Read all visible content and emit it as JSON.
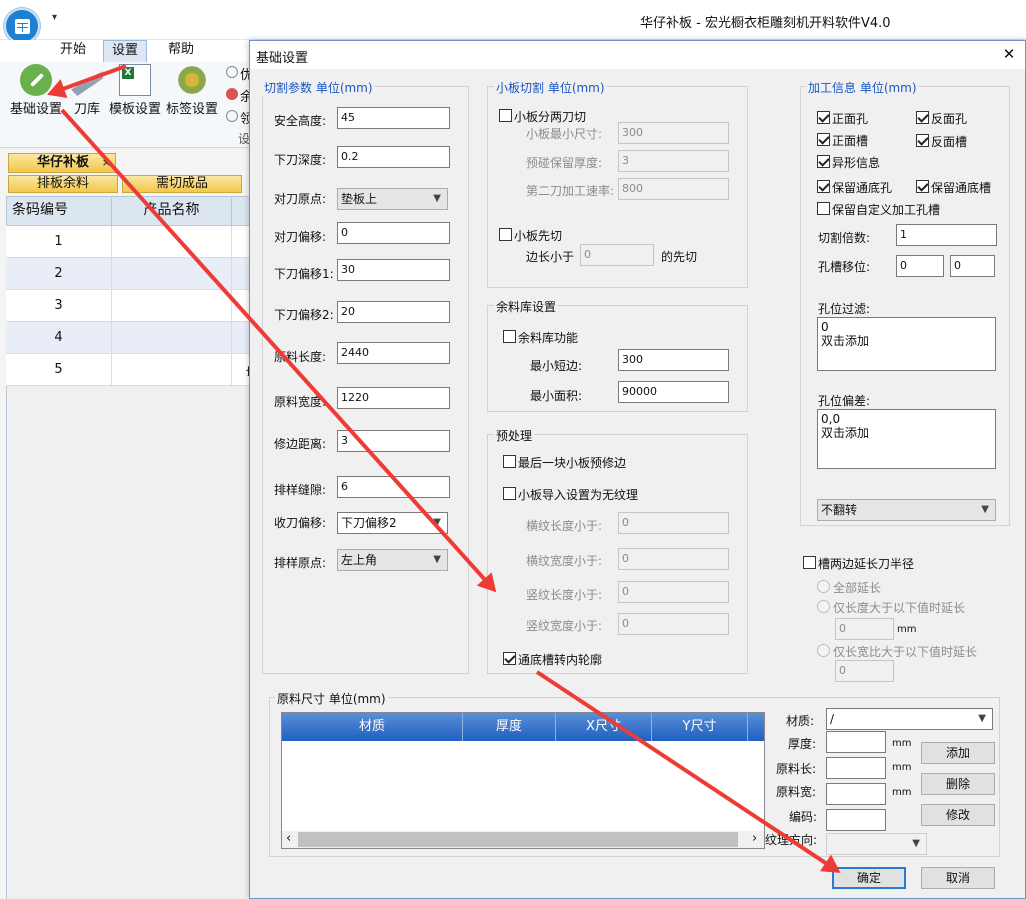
{
  "window": {
    "title": "华仔补板 - 宏光橱衣柜雕刻机开料软件V4.0",
    "qa_glyph": "▾"
  },
  "menu": {
    "items": [
      "开始",
      "设置",
      "帮助"
    ]
  },
  "ribbon": {
    "buttons": [
      "基础设置",
      "刀库",
      "模板设置",
      "标签设置"
    ],
    "partial": [
      "优",
      "余",
      "领",
      "设"
    ]
  },
  "doc_tab": {
    "label": "华仔补板",
    "close": "×"
  },
  "sub_tabs": [
    "排板余料",
    "需切成品"
  ],
  "grid": {
    "headers": [
      "条码编号",
      "产品名称"
    ],
    "rows": [
      "1",
      "2",
      "3",
      "4",
      "5"
    ],
    "row5_fragment": "切"
  },
  "dialog": {
    "title": "基础设置",
    "close": "✕",
    "cut_params": {
      "title": "切割参数 单位(mm)",
      "fields": [
        {
          "label": "安全高度:",
          "value": "45"
        },
        {
          "label": "下刀深度:",
          "value": "0.2"
        },
        {
          "label": "对刀原点:",
          "value": "垫板上"
        },
        {
          "label": "对刀偏移:",
          "value": "0"
        },
        {
          "label": "下刀偏移1:",
          "value": "30"
        },
        {
          "label": "下刀偏移2:",
          "value": "20"
        },
        {
          "label": "原料长度:",
          "value": "2440"
        },
        {
          "label": "原料宽度:",
          "value": "1220"
        },
        {
          "label": "修边距离:",
          "value": "3"
        },
        {
          "label": "排样缝隙:",
          "value": "6"
        },
        {
          "label": "收刀偏移:",
          "value": "下刀偏移2"
        },
        {
          "label": "排样原点:",
          "value": "左上角"
        }
      ]
    },
    "small_cut": {
      "title": "小板切割 单位(mm)",
      "two_cut": "小板分两刀切",
      "min_size_label": "小板最小尺寸:",
      "min_size": "300",
      "keep_thick_label": "预碰保留厚度:",
      "keep_thick": "3",
      "speed_label": "第二刀加工速率:",
      "speed": "800",
      "first_cut": "小板先切",
      "edge_prefix": "边长小于",
      "edge_value": "0",
      "edge_suffix": "的先切"
    },
    "remnant": {
      "title": "余料库设置",
      "enable": "余料库功能",
      "min_short_label": "最小短边:",
      "min_short": "300",
      "min_area_label": "最小面积:",
      "min_area": "90000"
    },
    "preprocess": {
      "title": "预处理",
      "last_trim": "最后一块小板预修边",
      "no_grain": "小板导入设置为无纹理",
      "rows": [
        {
          "label": "横纹长度小于:",
          "value": "0"
        },
        {
          "label": "横纹宽度小于:",
          "value": "0"
        },
        {
          "label": "竖纹长度小于:",
          "value": "0"
        },
        {
          "label": "竖纹宽度小于:",
          "value": "0"
        }
      ],
      "groove_contour": "通底槽转内轮廓"
    },
    "process_info": {
      "title": "加工信息 单位(mm)",
      "front_hole": "正面孔",
      "back_hole": "反面孔",
      "front_groove": "正面槽",
      "back_groove": "反面槽",
      "shaped": "异形信息",
      "keep_hole": "保留通底孔",
      "keep_groove": "保留通底槽",
      "keep_custom": "保留自定义加工孔槽",
      "mult_label": "切割倍数:",
      "mult_value": "1",
      "shift_label": "孔槽移位:",
      "shift_x": "0",
      "shift_y": "0",
      "filter_label": "孔位过滤:",
      "filter_lines": [
        "0",
        "双击添加"
      ],
      "deviation_label": "孔位偏差:",
      "deviation_lines": [
        "0,0",
        "双击添加"
      ],
      "flip": "不翻转"
    },
    "groove_ext": {
      "title": "槽两边延长刀半径",
      "all": "全部延长",
      "len_only": "仅长度大于以下值时延长",
      "len_value": "0",
      "unit": "mm",
      "ratio_only": "仅长宽比大于以下值时延长",
      "ratio_value": "0"
    },
    "material": {
      "title": "原料尺寸 单位(mm)",
      "columns": [
        "材质",
        "厚度",
        "X尺寸",
        "Y尺寸"
      ],
      "mat_label": "材质:",
      "mat_value": "/",
      "thick_label": "厚度:",
      "len_label": "原料长:",
      "wid_label": "原料宽:",
      "code_label": "编码:",
      "grain_label": "纹理方向:",
      "unit": "mm",
      "add": "添加",
      "delete": "删除",
      "modify": "修改",
      "scroll_left": "‹",
      "scroll_right": "›"
    },
    "ok": "确定",
    "cancel": "取消"
  },
  "colors": {
    "accent": "#1a56c2",
    "annotation": "#ef3b35",
    "tab": "#f2c84b"
  }
}
